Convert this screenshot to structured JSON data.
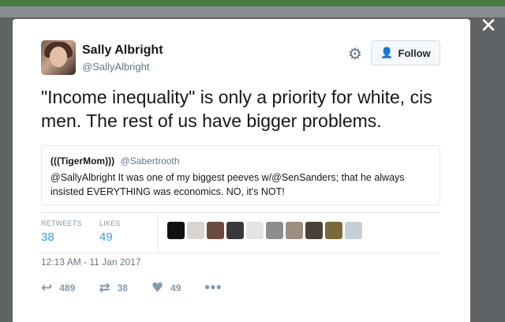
{
  "window": {
    "close_glyph": "✕"
  },
  "author": {
    "name": "Sally Albright",
    "handle": "@SallyAlbright",
    "avatar_icon": "profile-photo"
  },
  "header": {
    "follow_label": "Follow",
    "follow_icon": "add-person-icon",
    "settings_icon": "gear-icon"
  },
  "tweet": {
    "text": "\"Income inequality\" is only a priority for white, cis men. The rest of us have bigger problems."
  },
  "quoted_tweet": {
    "name": "(((TigerMom)))",
    "handle": "@Sabertrooth",
    "text": "@SallyAlbright It was one of my biggest peeves w/@SenSanders; that he always insisted EVERYTHING was economics. NO, it's NOT!"
  },
  "stats": {
    "retweets_label": "RETWEETS",
    "retweets": "38",
    "likes_label": "LIKES",
    "likes": "49"
  },
  "likers": {
    "colors": [
      "#111111",
      "#d8d4cf",
      "#6a4b3c",
      "#3a3a3a",
      "#e4e4e4",
      "#8d8d8d",
      "#9a8f7d",
      "#4b4038",
      "#7a6a3a",
      "#c5cfd8"
    ]
  },
  "timestamp": "12:13 AM - 11 Jan 2017",
  "actions": {
    "reply_count": "489",
    "retweet_count": "38",
    "like_count": "49",
    "more_glyph": "•••"
  },
  "colors": {
    "accent": "#3b9bdc",
    "muted": "#657786"
  }
}
